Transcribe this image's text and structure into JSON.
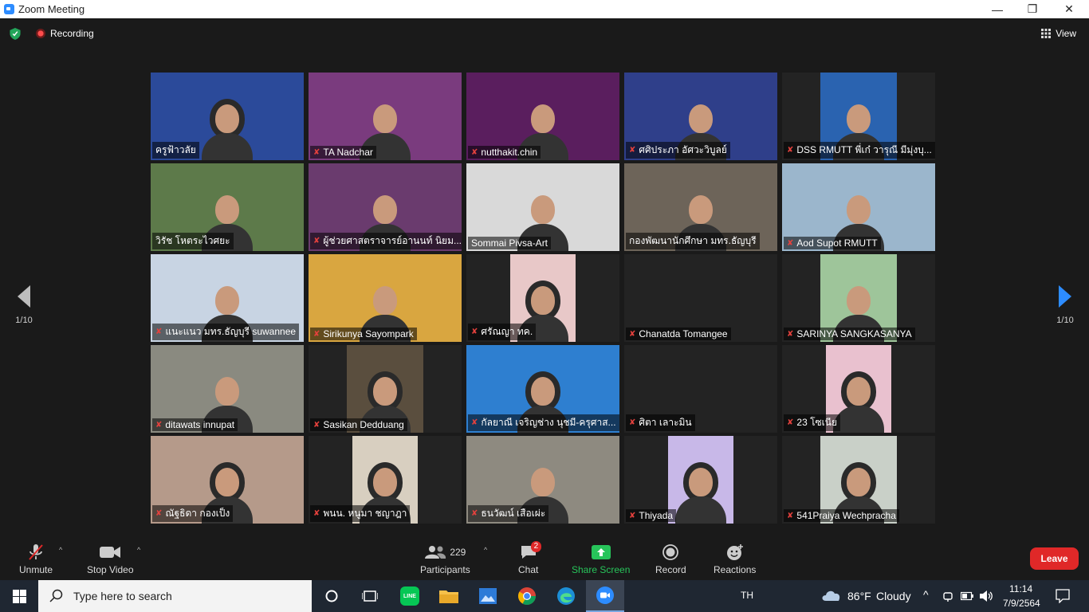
{
  "window": {
    "title": "Zoom Meeting",
    "minimize_glyph": "—",
    "restore_glyph": "❐",
    "close_glyph": "✕"
  },
  "topbar": {
    "recording_label": "Recording",
    "view_label": "View"
  },
  "pagination": {
    "left_label": "1/10",
    "right_label": "1/10"
  },
  "participants_grid": [
    {
      "name": "ครูฟ้าวลัย",
      "muted": false,
      "active": true,
      "bg": "#2b4a9a",
      "video": true
    },
    {
      "name": "TA Nadchar",
      "muted": true,
      "bg": "#7a3b7e",
      "video": true
    },
    {
      "name": "nutthakit.chin",
      "muted": true,
      "bg": "#5a1e5e",
      "video": true
    },
    {
      "name": "ศศิประภา อัศวะวิบูลย์",
      "muted": true,
      "bg": "#2f3f8a",
      "video": true
    },
    {
      "name": "DSS RMUTT พี่เก๋ วารุณี มีมุ่งบุ...",
      "muted": true,
      "bg": "#2a63b0",
      "video": true
    },
    {
      "name": "วิรัช  โหตระไวศยะ",
      "muted": false,
      "bg": "#5d7a4a",
      "video": true
    },
    {
      "name": "ผู้ช่วยศาสตราจารย์อานนท์ นิยม...",
      "muted": true,
      "bg": "#6a3b6e",
      "video": true
    },
    {
      "name": "Sommai Pivsa-Art",
      "muted": false,
      "bg": "#d9d9d9",
      "video": true
    },
    {
      "name": "กองพัฒนานักศึกษา มทร.ธัญบุรี",
      "muted": false,
      "bg": "#6d6459",
      "video": true
    },
    {
      "name": "Aod Supot RMUTT",
      "muted": true,
      "bg": "#9bb6cc",
      "video": true
    },
    {
      "name": "แนะแนว มทร.ธัญบุรี suwannee",
      "muted": true,
      "bg": "#c8d4e3",
      "video": true
    },
    {
      "name": "Sirikunya Sayompark",
      "muted": true,
      "bg": "#d9a640",
      "video": true
    },
    {
      "name": "ศรัณญา ทค.",
      "muted": true,
      "bg": "#e8c8c8",
      "video": true
    },
    {
      "name": "Chanatda Tomangee",
      "muted": true,
      "bg": "#232323",
      "video": false
    },
    {
      "name": "SARINYA SANGKASANYA",
      "muted": true,
      "bg": "#9ec59a",
      "video": true
    },
    {
      "name": "ditawats innupat",
      "muted": true,
      "bg": "#8a8a80",
      "video": true
    },
    {
      "name": "Sasikan Dedduang",
      "muted": true,
      "bg": "#5a4e3e",
      "video": true
    },
    {
      "name": "กัลยาณี เจริญช่าง นุชมี-ครุศาส...",
      "muted": true,
      "bg": "#2e7fd0",
      "video": true
    },
    {
      "name": "ศิตา เลาะมิน",
      "muted": true,
      "bg": "#232323",
      "video": false
    },
    {
      "name": "23 โซเนีย",
      "muted": true,
      "bg": "#e9c1cf",
      "video": true
    },
    {
      "name": "ณัฐธิดา กองเป็ง",
      "muted": true,
      "bg": "#b59a8a",
      "video": true
    },
    {
      "name": "พนน. หนูมา ชญาฎา",
      "muted": true,
      "bg": "#d8cfc0",
      "video": true
    },
    {
      "name": "ธนวัฒน์ เสือเผ่ะ",
      "muted": true,
      "bg": "#8e8a80",
      "video": true
    },
    {
      "name": "Thiyada",
      "muted": true,
      "bg": "#c8b8e8",
      "video": true
    },
    {
      "name": "541Praiya Wechpracha",
      "muted": true,
      "bg": "#c9d0c8",
      "video": true
    }
  ],
  "controls": {
    "unmute_label": "Unmute",
    "stop_video_label": "Stop Video",
    "participants_label": "Participants",
    "participants_count": "229",
    "chat_label": "Chat",
    "chat_badge": "2",
    "share_label": "Share Screen",
    "record_label": "Record",
    "reactions_label": "Reactions",
    "leave_label": "Leave"
  },
  "taskbar": {
    "search_placeholder": "Type here to search",
    "language": "TH",
    "weather_temp": "86°F",
    "weather_desc": "Cloudy",
    "time": "11:14",
    "date": "7/9/2564"
  },
  "colors": {
    "accent_blue": "#2d8cff",
    "leave_red": "#e02828",
    "share_green": "#27c45a",
    "active_speaker": "#e8e06b"
  }
}
